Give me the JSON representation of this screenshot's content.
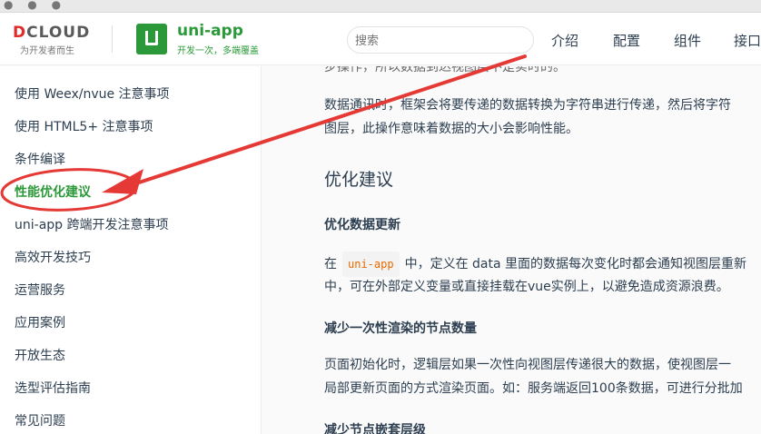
{
  "colors": {
    "brand": "#2b9939",
    "annotation": "#e53935",
    "code": "#e96900"
  },
  "header": {
    "brand_word": "CLOUD",
    "brand_letter": "D",
    "brand_sub": "为开发者而生",
    "app_name": "uni-app",
    "app_slogan": "开发一次，多端覆盖",
    "search_placeholder": "搜索",
    "nav": [
      "介绍",
      "配置",
      "组件",
      "接口"
    ]
  },
  "sidebar": {
    "items": [
      "使用 Weex/nvue 注意事项",
      "使用 HTML5+ 注意事项",
      "条件编译",
      "性能优化建议",
      "uni-app 跨端开发注意事项",
      "高效开发技巧",
      "运营服务",
      "应用案例",
      "开放生态",
      "选型评估指南",
      "常见问题"
    ],
    "active_index": 3
  },
  "content": {
    "top_partial": "步操作，所以数据到达视图层不是实时的。",
    "para1_line1": "数据通讯时，框架会将要传递的数据转换为字符串进行传递，然后将字符",
    "para1_line2": "图层，此操作意味着数据的大小会影响性能。",
    "section_title": "优化建议",
    "h3_1": "优化数据更新",
    "para2_before": "在",
    "para2_code": "uni-app",
    "para2_after": "中，定义在 data 里面的数据每次变化时都会通知视图层重新",
    "para2_line2": "中，可在外部定义变量或直接挂载在vue实例上，以避免造成资源浪费。",
    "h3_2": "减少一次性渲染的节点数量",
    "para3_line1": "页面初始化时，逻辑层如果一次性向视图层传递很大的数据，使视图层一",
    "para3_line2": "局部更新页面的方式渲染页面。如：服务端返回100条数据，可进行分批加",
    "h3_3": "减少节点嵌套层级"
  }
}
